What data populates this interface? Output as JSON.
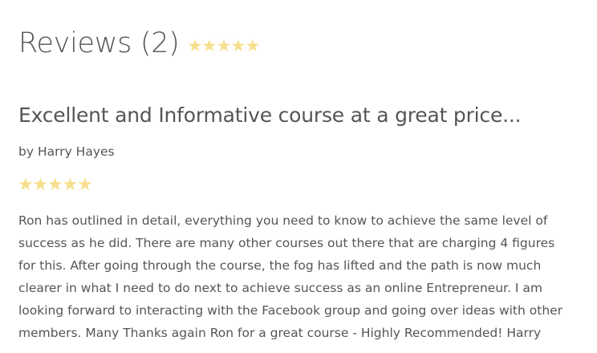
{
  "reviews": {
    "title": "Reviews (2)",
    "average_rating": 5,
    "max_rating": 5,
    "star_color": "#f6df8c"
  },
  "review": {
    "title": "Excellent and Informative course at a great price...",
    "author": "by Harry Hayes",
    "rating": 5,
    "max_rating": 5,
    "body": "Ron has outlined in detail, everything you need to know to achieve the same level of success as he did. There are many other courses out there that are charging 4 figures for this. After going through the course, the fog has lifted and the path is now much clearer in what I need to do next to achieve success as an online Entrepreneur. I am looking forward to interacting with the Facebook group and going over ideas with other members. Many Thanks again Ron for a great course - Highly Recommended! Harry"
  }
}
